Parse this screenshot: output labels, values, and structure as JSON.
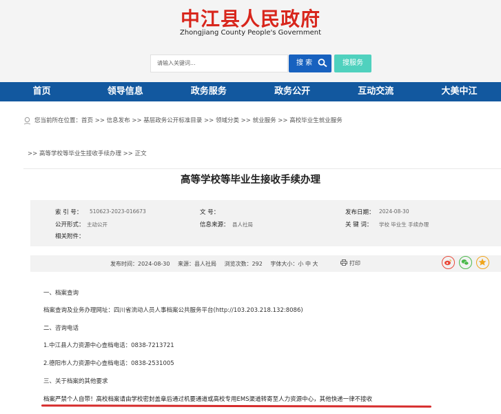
{
  "header": {
    "site_title_cn": "中江县人民政府",
    "site_title_en": "Zhongjiang County People's Government",
    "search_placeholder": "请输入关键词...",
    "search_button": "搜 索",
    "service_button": "搜服务"
  },
  "nav": [
    "首页",
    "领导信息",
    "政务服务",
    "政务公开",
    "互动交流",
    "大美中江"
  ],
  "breadcrumb": {
    "line1": "您当前所在位置：首页 >> 信息发布 >> 基层政务公开标准目录 >> 领域分类 >> 就业服务 >> 高校毕业生就业服务",
    "line2": ">> 高等学校等毕业生接收手续办理 >> 正文"
  },
  "article": {
    "title": "高等学校等毕业生接收手续办理",
    "meta": {
      "index_label": "索 引 号：",
      "index_value": "510623-2023-016673",
      "doc_no_label": "文 号：",
      "doc_no_value": "",
      "publish_date_label": "发布日期：",
      "publish_date_value": "2024-08-30",
      "public_form_label": "公开形式：",
      "public_form_value": "主动公开",
      "source_label": "信息来源：",
      "source_value": "县人社局",
      "keywords_label": "关 键 词：",
      "keywords_value": "学校 毕业生 手续办理",
      "attachments_label": "相关附件："
    },
    "info_bar": {
      "publish_time": "发布时间：2024-08-30",
      "source": "来源：县人社局",
      "views": "浏览次数：292",
      "font_size": "字体大小：小 中 大",
      "print": "打印"
    },
    "paragraphs": [
      "一、档案查询",
      "档案查询及业务办理网址：四川省流动人员人事档案公共服务平台(http://103.203.218.132:8086)",
      "二、咨询电话",
      "1.中江县人力资源中心查档电话：0838-7213721",
      "2.德阳市人力资源中心查档电话：0838-2531005",
      "三、关于档案的其他要求",
      "档案严禁个人自带！高校档案请由学校密封盖章后通过机要通道或高校专用EMS渠道转寄至人力资源中心，其他快递一律不接收"
    ]
  },
  "colors": {
    "brand_red": "#d8261c",
    "nav_blue": "#12589f",
    "search_blue": "#1761bf",
    "service_teal": "#4fd1be",
    "underline_red": "#d62b2b"
  }
}
